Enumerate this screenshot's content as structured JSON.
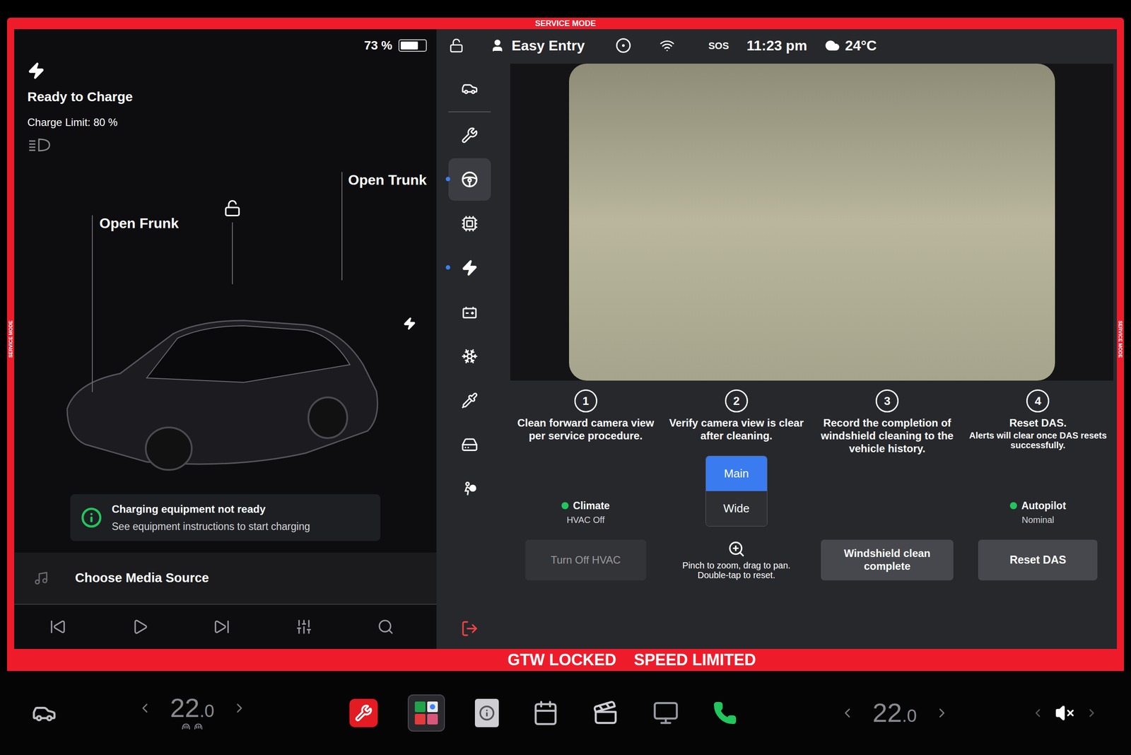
{
  "banner": "SERVICE MODE",
  "side_labels": [
    "SERVICE MODE",
    "SERVICE MODE"
  ],
  "battery": {
    "reading": "73 %",
    "level": 0.73
  },
  "status_bar": {
    "profile": "Easy Entry",
    "sos": "SOS",
    "time": "11:23 pm",
    "temperature": "24°C"
  },
  "charge": {
    "title": "Ready to Charge",
    "limit": "Charge Limit: 80 %"
  },
  "car_controls": [
    {
      "label": "Open Frunk"
    },
    {
      "label": "Open Trunk"
    }
  ],
  "notice": {
    "title": "Charging equipment not ready",
    "message": "See equipment instructions to start charging"
  },
  "media": {
    "title": "Choose Media Source"
  },
  "sidebar": {
    "items": [
      {
        "kind": "car",
        "selected": false,
        "dot": false
      },
      {
        "kind": "service",
        "selected": false,
        "dot": false
      },
      {
        "kind": "autopilot",
        "selected": true,
        "dot": true
      },
      {
        "kind": "hardware",
        "selected": false,
        "dot": false
      },
      {
        "kind": "charging",
        "selected": false,
        "dot": true
      },
      {
        "kind": "battery",
        "selected": false,
        "dot": false
      },
      {
        "kind": "climate",
        "selected": false,
        "dot": false
      },
      {
        "kind": "tools",
        "selected": false,
        "dot": false
      },
      {
        "kind": "storage",
        "selected": false,
        "dot": false
      },
      {
        "kind": "safety",
        "selected": false,
        "dot": false
      }
    ]
  },
  "camera_steps": [
    {
      "number": "1",
      "title": "Clean forward camera view per service procedure.",
      "note": ""
    },
    {
      "number": "2",
      "title": "Verify camera view is clear after cleaning.",
      "note": ""
    },
    {
      "number": "3",
      "title": "Record the completion of windshield cleaning to the vehicle history.",
      "note": ""
    },
    {
      "number": "4",
      "title": "Reset DAS.",
      "note": "Alerts will clear once DAS resets successfully."
    }
  ],
  "view_toggle": [
    {
      "label": "Main",
      "selected": true
    },
    {
      "label": "Wide",
      "selected": false
    }
  ],
  "climate": {
    "label": "Climate",
    "value": "HVAC Off",
    "ok": true
  },
  "turn_off_hvac": {
    "label": "Turn Off HVAC",
    "disabled": true
  },
  "zoom_hint": [
    "Pinch to zoom, drag to pan.",
    "Double-tap to reset."
  ],
  "windshield_button": {
    "label": "Windshield clean complete"
  },
  "autopilot": {
    "label": "Autopilot",
    "value": "Nominal",
    "ok": true
  },
  "reset_button": {
    "label": "Reset DAS"
  },
  "alerts": [
    "GTW LOCKED",
    "SPEED LIMITED"
  ],
  "bottom_bar": {
    "driver_temp": {
      "whole": "22",
      "decimal": ".0"
    },
    "passenger_temp": {
      "whole": "22",
      "decimal": ".0"
    },
    "apps": [
      {
        "kind": "service",
        "selected": false
      },
      {
        "kind": "toybox",
        "selected": true
      },
      {
        "kind": "manual",
        "selected": false
      },
      {
        "kind": "calendar",
        "selected": false
      },
      {
        "kind": "theater",
        "selected": false
      },
      {
        "kind": "screen",
        "selected": false
      },
      {
        "kind": "phone",
        "selected": false
      }
    ],
    "muted": true
  }
}
